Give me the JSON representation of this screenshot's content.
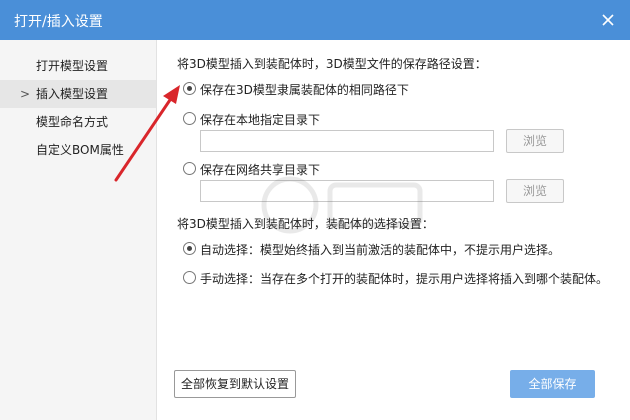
{
  "window": {
    "title": "打开/插入设置"
  },
  "sidebar": {
    "items": [
      {
        "label": "打开模型设置"
      },
      {
        "label": "插入模型设置",
        "active": true
      },
      {
        "label": "模型命名方式"
      },
      {
        "label": "自定义BOM属性"
      }
    ],
    "active_marker": ">"
  },
  "main": {
    "path_heading": "将3D模型插入到装配体时，3D模型文件的保存路径设置：",
    "path_options": [
      {
        "label": "保存在3D模型隶属装配体的相同路径下",
        "checked": true
      },
      {
        "label": "保存在本地指定目录下",
        "checked": false,
        "input_value": "",
        "browse_label": "浏览"
      },
      {
        "label": "保存在网络共享目录下",
        "checked": false,
        "input_value": "",
        "browse_label": "浏览"
      }
    ],
    "select_heading": "将3D模型插入到装配体时，装配体的选择设置：",
    "select_options": [
      {
        "label": "自动选择：模型始终插入到当前激活的装配体中，不提示用户选择。",
        "checked": true
      },
      {
        "label": "手动选择：当存在多个打开的装配体时，提示用户选择将插入到哪个装配体。",
        "checked": false
      }
    ],
    "reset_label": "全部恢复到默认设置",
    "save_label": "全部保存"
  },
  "colors": {
    "titlebar": "#4a8fd8",
    "save_button": "#77aee9",
    "annotation_arrow": "#d9262b"
  },
  "icons": {
    "close": "close-icon",
    "annotation": "red-arrow"
  }
}
